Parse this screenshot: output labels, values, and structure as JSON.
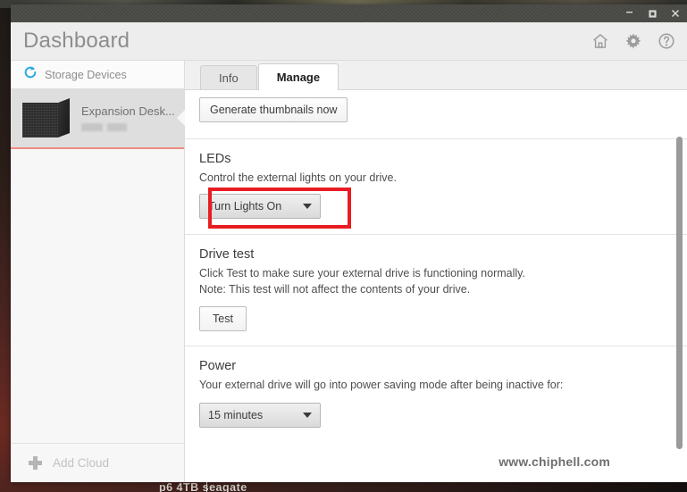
{
  "window": {
    "controls": {
      "minimize": "minimize-button",
      "maximize": "maximize-button",
      "close": "close-button"
    }
  },
  "header": {
    "title": "Dashboard",
    "icons": [
      {
        "name": "home-icon"
      },
      {
        "name": "gear-icon"
      },
      {
        "name": "help-icon"
      }
    ]
  },
  "sidebar": {
    "storage_label": "Storage Devices",
    "device": {
      "name": "Expansion Desk...",
      "subtitle_redacted": true
    },
    "add_cloud_label": "Add Cloud"
  },
  "tabs": [
    {
      "label": "Info",
      "active": false
    },
    {
      "label": "Manage",
      "active": true
    }
  ],
  "sections": {
    "thumbnails": {
      "button_label": "Generate thumbnails now"
    },
    "leds": {
      "title": "LEDs",
      "description": "Control the external lights on your drive.",
      "dropdown_value": "Turn Lights On",
      "highlight_color": "#e81d22"
    },
    "drive_test": {
      "title": "Drive test",
      "description_line1": "Click Test to make sure your external drive is functioning normally.",
      "description_line2": "Note: This test will not affect the contents of your drive.",
      "button_label": "Test"
    },
    "power": {
      "title": "Power",
      "description": "Your external drive will go into power saving mode after being inactive for:",
      "dropdown_value": "15 minutes"
    }
  },
  "watermark": {
    "url": "www.chiphell.com",
    "logo": "chiphell-logo"
  },
  "desktop": {
    "bottom_text": "p6 4TB seagate"
  },
  "colors": {
    "accent_device_underline": "#ef8d80",
    "storage_icon": "#29abe2",
    "highlight_red": "#e81d22",
    "header_bg": "#ededed"
  }
}
